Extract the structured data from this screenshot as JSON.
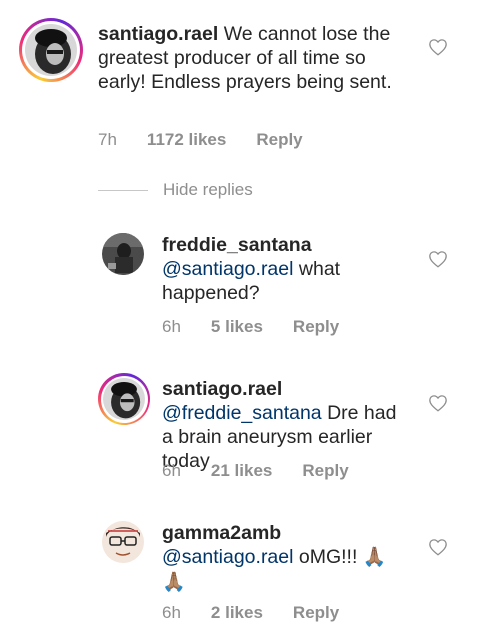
{
  "comments": [
    {
      "username": "santiago.rael",
      "text": " We cannot lose the greatest producer of all time so early! Endless prayers being sent.",
      "time": "7h",
      "likes": "1172 likes",
      "reply": "Reply"
    },
    {
      "username": "freddie_santana",
      "mention": "@santiago.rael",
      "text": " what happened?",
      "time": "6h",
      "likes": "5 likes",
      "reply": "Reply"
    },
    {
      "username": "santiago.rael",
      "mention": "@freddie_santana",
      "text": " Dre had a brain aneurysm earlier today",
      "time": "6h",
      "likes": "21 likes",
      "reply": "Reply"
    },
    {
      "username": "gamma2amb",
      "mention": "@santiago.rael",
      "text": " oMG!!! ",
      "emoji": "🙏🏽",
      "emoji2": "🙏🏽",
      "time": "6h",
      "likes": "2 likes",
      "reply": "Reply"
    }
  ],
  "hide_replies": "Hide replies",
  "icons": {
    "like": "heart-outline-icon"
  },
  "colors": {
    "text": "#262626",
    "muted": "#8e8e8e",
    "mention": "#003569"
  }
}
